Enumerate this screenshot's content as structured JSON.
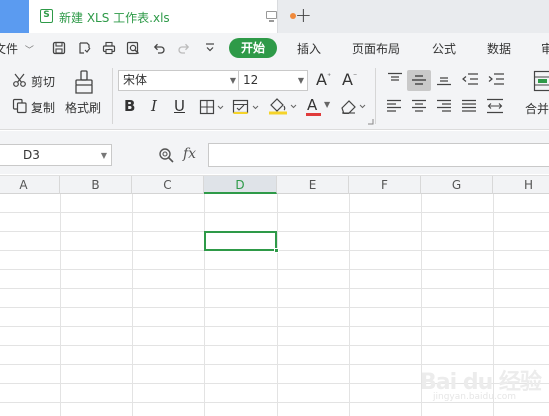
{
  "tabs": {
    "file_icon_letter": "S",
    "file_name": "新建 XLS 工作表.xls",
    "new_tab": "+"
  },
  "menu": {
    "file_label": "文件",
    "start": "开始",
    "insert": "插入",
    "page_layout": "页面布局",
    "formula": "公式",
    "data": "数据",
    "review_partial": "审"
  },
  "ribbon": {
    "cut": "剪切",
    "copy": "复制",
    "format_painter": "格式刷",
    "font_name": "宋体",
    "font_size": "12",
    "bold": "B",
    "italic": "I",
    "underline": "U",
    "grow_font": "A",
    "shrink_font": "A",
    "font_color_letter": "A",
    "merge_partial": "合并"
  },
  "formula_bar": {
    "name_box": "D3",
    "fx": "fx",
    "formula": ""
  },
  "sheet": {
    "columns": [
      "A",
      "B",
      "C",
      "D",
      "E",
      "F",
      "G",
      "H"
    ],
    "active_column": "D",
    "active_cell": "D3"
  },
  "watermark": {
    "main": "Bai du 经验",
    "sub": "jingyan.baidu.com"
  },
  "colors": {
    "accent_green": "#2e9a48",
    "tab_blue": "#5b9bf0",
    "highlight_yellow": "#f5d32a",
    "font_red": "#e03b3b"
  }
}
